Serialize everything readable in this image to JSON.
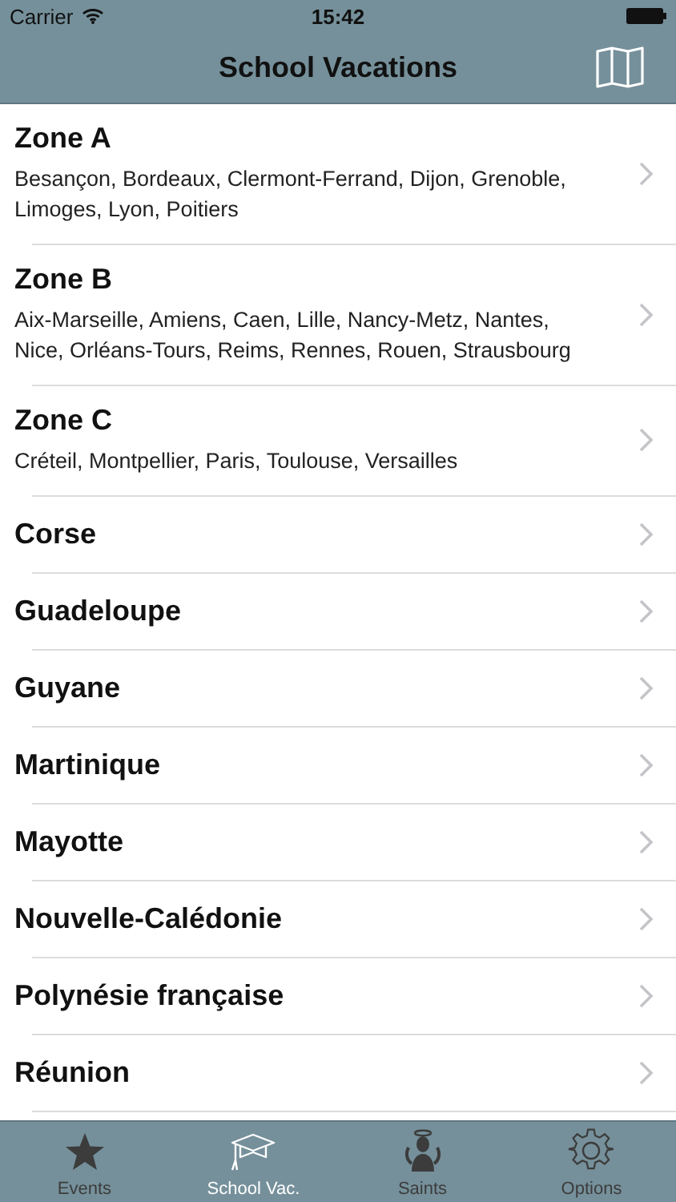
{
  "status_bar": {
    "carrier": "Carrier",
    "time": "15:42"
  },
  "nav_bar": {
    "title": "School Vacations"
  },
  "rows": [
    {
      "title": "Zone A",
      "subtitle": "Besançon, Bordeaux, Clermont-Ferrand, Dijon, Grenoble, Limoges, Lyon, Poitiers"
    },
    {
      "title": "Zone B",
      "subtitle": "Aix-Marseille, Amiens, Caen, Lille, Nancy-Metz, Nantes, Nice, Orléans-Tours, Reims, Rennes, Rouen, Strausbourg"
    },
    {
      "title": "Zone C",
      "subtitle": "Créteil, Montpellier, Paris, Toulouse, Versailles"
    },
    {
      "title": "Corse"
    },
    {
      "title": "Guadeloupe"
    },
    {
      "title": "Guyane"
    },
    {
      "title": "Martinique"
    },
    {
      "title": "Mayotte"
    },
    {
      "title": "Nouvelle-Calédonie"
    },
    {
      "title": "Polynésie française"
    },
    {
      "title": "Réunion"
    }
  ],
  "tabs": [
    {
      "label": "Events",
      "kind": "star",
      "selected": false
    },
    {
      "label": "School Vac.",
      "kind": "cap",
      "selected": true
    },
    {
      "label": "Saints",
      "kind": "saint",
      "selected": false
    },
    {
      "label": "Options",
      "kind": "gear",
      "selected": false
    }
  ]
}
